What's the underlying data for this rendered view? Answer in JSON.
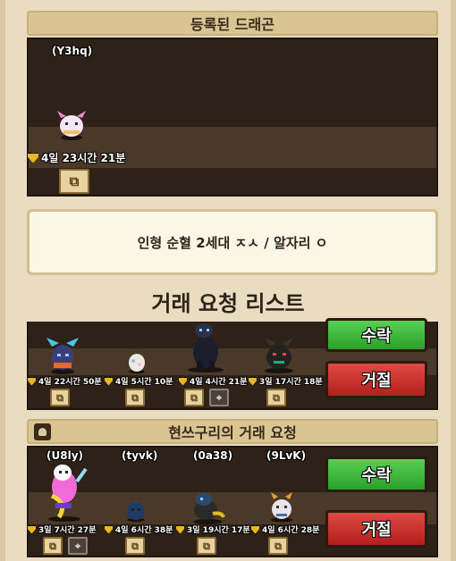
{
  "registered": {
    "title": "등록된 드래곤",
    "owner": "(Y3hq)",
    "timer": "4일 23시간 21분",
    "chip_icon": "dragon-info-icon"
  },
  "message": "인형 순혈 2세대 ㅈㅅ / 알자리 ㅇ",
  "list_title": "거래 요청 리스트",
  "request_one": {
    "timers": [
      "4일 22시간 50분",
      "4일 5시간 10분",
      "4일 4시간 21분",
      "3일 17시간 18분"
    ],
    "accept": "수락",
    "reject": "거절"
  },
  "request_two": {
    "title": "현쓰구리의 거래 요청",
    "owners": [
      "(U8ly)",
      "(tyvk)",
      "(0a38)",
      "(9LvK)"
    ],
    "timers": [
      "3일 7시간 27분",
      "4일 6시간 38분",
      "3일 19시간 17분",
      "4일 6시간 28분"
    ],
    "accept": "수락",
    "reject": "거절"
  },
  "colors": {
    "accept": "#2ca02a",
    "reject": "#b21f1c",
    "panel": "#2e2218",
    "background": "#e9dcc0"
  }
}
